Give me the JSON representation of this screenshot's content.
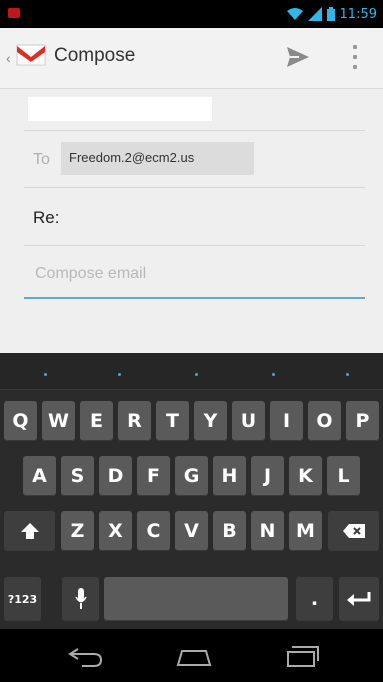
{
  "status_bar": {
    "time": "11:59",
    "icons": [
      "notification-icon",
      "wifi-icon",
      "signal-icon",
      "battery-icon"
    ]
  },
  "action_bar": {
    "title": "Compose",
    "icons": [
      "gmail-icon",
      "send-icon",
      "overflow-menu-icon"
    ]
  },
  "compose": {
    "to_label": "To",
    "recipient": "Freedom.2@ecm2.us",
    "subject": "Re:",
    "body_placeholder": "Compose email"
  },
  "keyboard": {
    "row1": [
      "Q",
      "W",
      "E",
      "R",
      "T",
      "Y",
      "U",
      "I",
      "O",
      "P"
    ],
    "row2": [
      "A",
      "S",
      "D",
      "F",
      "G",
      "H",
      "J",
      "K",
      "L"
    ],
    "row3": [
      "Z",
      "X",
      "C",
      "V",
      "B",
      "N",
      "M"
    ],
    "symbols_key": "?123",
    "period_key": ".",
    "icons": [
      "shift-icon",
      "backspace-icon",
      "mic-icon",
      "enter-icon"
    ]
  },
  "nav_bar": {
    "icons": [
      "back-icon",
      "home-icon",
      "recent-apps-icon"
    ]
  },
  "colors": {
    "accent": "#33b5e5",
    "gmail_red": "#d93025",
    "keyboard_bg": "#2b2b2b",
    "key_bg": "#5a5a5a"
  }
}
